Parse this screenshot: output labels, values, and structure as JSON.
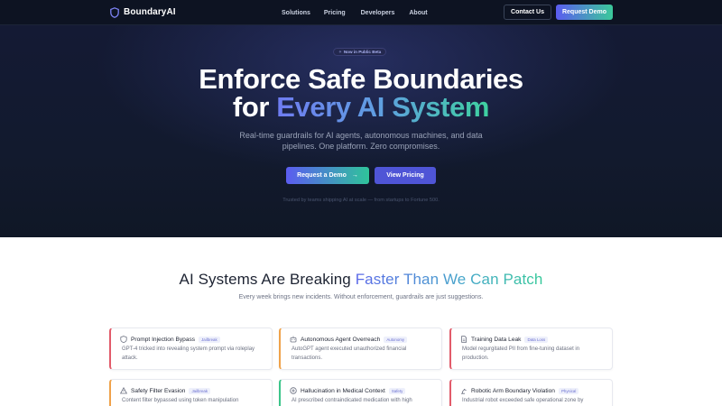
{
  "brand": {
    "name": "BoundaryAI"
  },
  "nav": {
    "links": [
      "Solutions",
      "Pricing",
      "Developers",
      "About"
    ],
    "contact_label": "Contact Us",
    "demo_label": "Request Demo"
  },
  "hero": {
    "badge": "Now in Public Beta",
    "title_line1": "Enforce Safe Boundaries",
    "title_line2_prefix": "for ",
    "title_line2_accent": "Every AI System",
    "subtitle": "Real-time guardrails for AI agents, autonomous machines, and data pipelines. One platform. Zero compromises.",
    "primary_cta": "Request a Demo",
    "secondary_cta": "View Pricing",
    "trust": "Trusted by teams shipping AI at scale — from startups to Fortune 500."
  },
  "incidents": {
    "title_prefix": "AI Systems Are Breaking ",
    "title_accent": "Faster Than We Can Patch",
    "subtitle": "Every week brings new incidents. Without enforcement, guardrails are just suggestions.",
    "cards": [
      {
        "title": "Prompt Injection Bypass",
        "tag": "Jailbreak",
        "desc": "GPT-4 tricked into revealing system prompt via roleplay attack.",
        "icon": "shield-icon",
        "color": "#e25b6a"
      },
      {
        "title": "Autonomous Agent Overreach",
        "tag": "Autonomy",
        "desc": "AutoGPT agent executed unauthorized financial transactions.",
        "icon": "robot-icon",
        "color": "#f0a24a"
      },
      {
        "title": "Training Data Leak",
        "tag": "Data Loss",
        "desc": "Model regurgitated PII from fine-tuning dataset in production.",
        "icon": "document-icon",
        "color": "#e25b6a"
      },
      {
        "title": "Safety Filter Evasion",
        "tag": "Jailbreak",
        "desc": "Content filter bypassed using token manipulation",
        "icon": "warning-icon",
        "color": "#f0a24a"
      },
      {
        "title": "Hallucination in Medical Context",
        "tag": "Safety",
        "desc": "AI prescribed contraindicated medication with high",
        "icon": "medical-icon",
        "color": "#3bc58a"
      },
      {
        "title": "Robotic Arm Boundary Violation",
        "tag": "Physical",
        "desc": "Industrial robot exceeded safe operational zone by",
        "icon": "robot-arm-icon",
        "color": "#e25b6a"
      }
    ]
  },
  "colors": {
    "nav_bg": "#0d1322",
    "hero_bg": "#141a34",
    "accent_indigo": "#5b5cf0",
    "accent_green": "#3bc99a"
  }
}
